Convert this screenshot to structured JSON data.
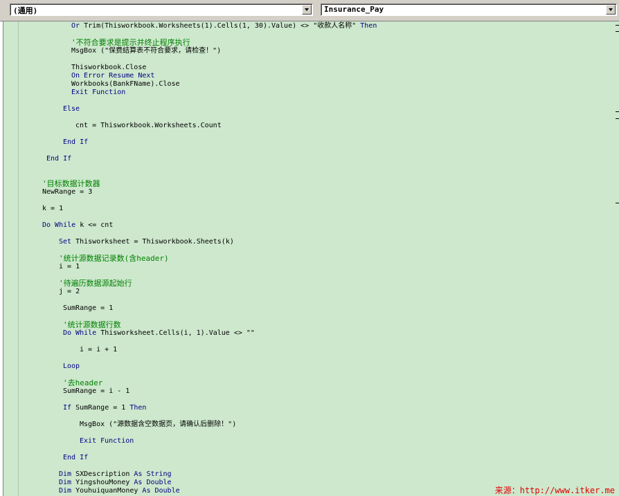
{
  "toolbar": {
    "object_combo": "(通用)",
    "procedure_combo": "Insurance_Pay"
  },
  "code_lines": [
    [
      {
        "t": "Or ",
        "c": "kw"
      },
      {
        "t": "Trim(Thisworkbook.Worksheets(1).Cells(1, 30).Value) <> \"收款人名称\" ",
        "c": "n"
      },
      {
        "t": "Then",
        "c": "kw"
      }
    ],
    [
      {
        "t": "'不符合要求是提示并终止程序执行",
        "c": "cm"
      }
    ],
    [
      {
        "t": "MsgBox (\"保费结算表不符合要求，请检查！\")",
        "c": "n"
      }
    ],
    [
      {
        "t": "Thisworkbook.Close",
        "c": "n"
      }
    ],
    [
      {
        "t": "On Error Resume Next",
        "c": "kw"
      }
    ],
    [
      {
        "t": "Workbooks(BankFName).Close",
        "c": "n"
      }
    ],
    [
      {
        "t": "Exit Function",
        "c": "kw"
      }
    ],
    [
      {
        "t": "Else",
        "c": "kw"
      }
    ],
    [
      {
        "t": "cnt = Thisworkbook.Worksheets.Count",
        "c": "n"
      }
    ],
    [
      {
        "t": "End If",
        "c": "kw"
      }
    ],
    [
      {
        "t": "End If",
        "c": "kw"
      }
    ],
    [
      {
        "t": "'目标数据计数器",
        "c": "cm"
      }
    ],
    [
      {
        "t": "NewRange = 3",
        "c": "n"
      }
    ],
    [
      {
        "t": "k = 1",
        "c": "n"
      }
    ],
    [
      {
        "t": "Do While ",
        "c": "kw"
      },
      {
        "t": "k <= cnt",
        "c": "n"
      }
    ],
    [
      {
        "t": "Set ",
        "c": "kw"
      },
      {
        "t": "Thisworksheet = Thisworkbook.Sheets(k)",
        "c": "n"
      }
    ],
    [
      {
        "t": "'统计源数据记录数(含header)",
        "c": "cm"
      }
    ],
    [
      {
        "t": "i = 1",
        "c": "n"
      }
    ],
    [
      {
        "t": "'待遍历数据源起始行",
        "c": "cm"
      }
    ],
    [
      {
        "t": "j = 2",
        "c": "n"
      }
    ],
    [
      {
        "t": "SumRange = 1",
        "c": "n"
      }
    ],
    [
      {
        "t": "'统计源数据行数",
        "c": "cm"
      }
    ],
    [
      {
        "t": "Do While ",
        "c": "kw"
      },
      {
        "t": "Thisworksheet.Cells(i, 1).Value <> \"\"",
        "c": "n"
      }
    ],
    [
      {
        "t": "i = i + 1",
        "c": "n"
      }
    ],
    [
      {
        "t": "Loop",
        "c": "kw"
      }
    ],
    [
      {
        "t": "'去header",
        "c": "cm"
      }
    ],
    [
      {
        "t": "SumRange = i - 1",
        "c": "n"
      }
    ],
    [
      {
        "t": "If ",
        "c": "kw"
      },
      {
        "t": "SumRange = 1 ",
        "c": "n"
      },
      {
        "t": "Then",
        "c": "kw"
      }
    ],
    [
      {
        "t": "MsgBox (\"源数据含空数据页，请确认后删除！\")",
        "c": "n"
      }
    ],
    [
      {
        "t": "Exit Function",
        "c": "kw"
      }
    ],
    [
      {
        "t": "End If",
        "c": "kw"
      }
    ],
    [
      {
        "t": "Dim ",
        "c": "kw"
      },
      {
        "t": "SXDescription ",
        "c": "n"
      },
      {
        "t": "As String",
        "c": "kw"
      }
    ],
    [
      {
        "t": "Dim ",
        "c": "kw"
      },
      {
        "t": "YingshouMoney ",
        "c": "n"
      },
      {
        "t": "As Double",
        "c": "kw"
      }
    ],
    [
      {
        "t": "Dim ",
        "c": "kw"
      },
      {
        "t": "YouhuiquanMoney ",
        "c": "n"
      },
      {
        "t": "As Double",
        "c": "kw"
      }
    ]
  ],
  "watermark": "来源：http://www.itker.me",
  "colors": {
    "editor_bg": "#cde8cd",
    "keyword": "#000080",
    "comment": "#008000",
    "watermark": "#e00000"
  }
}
